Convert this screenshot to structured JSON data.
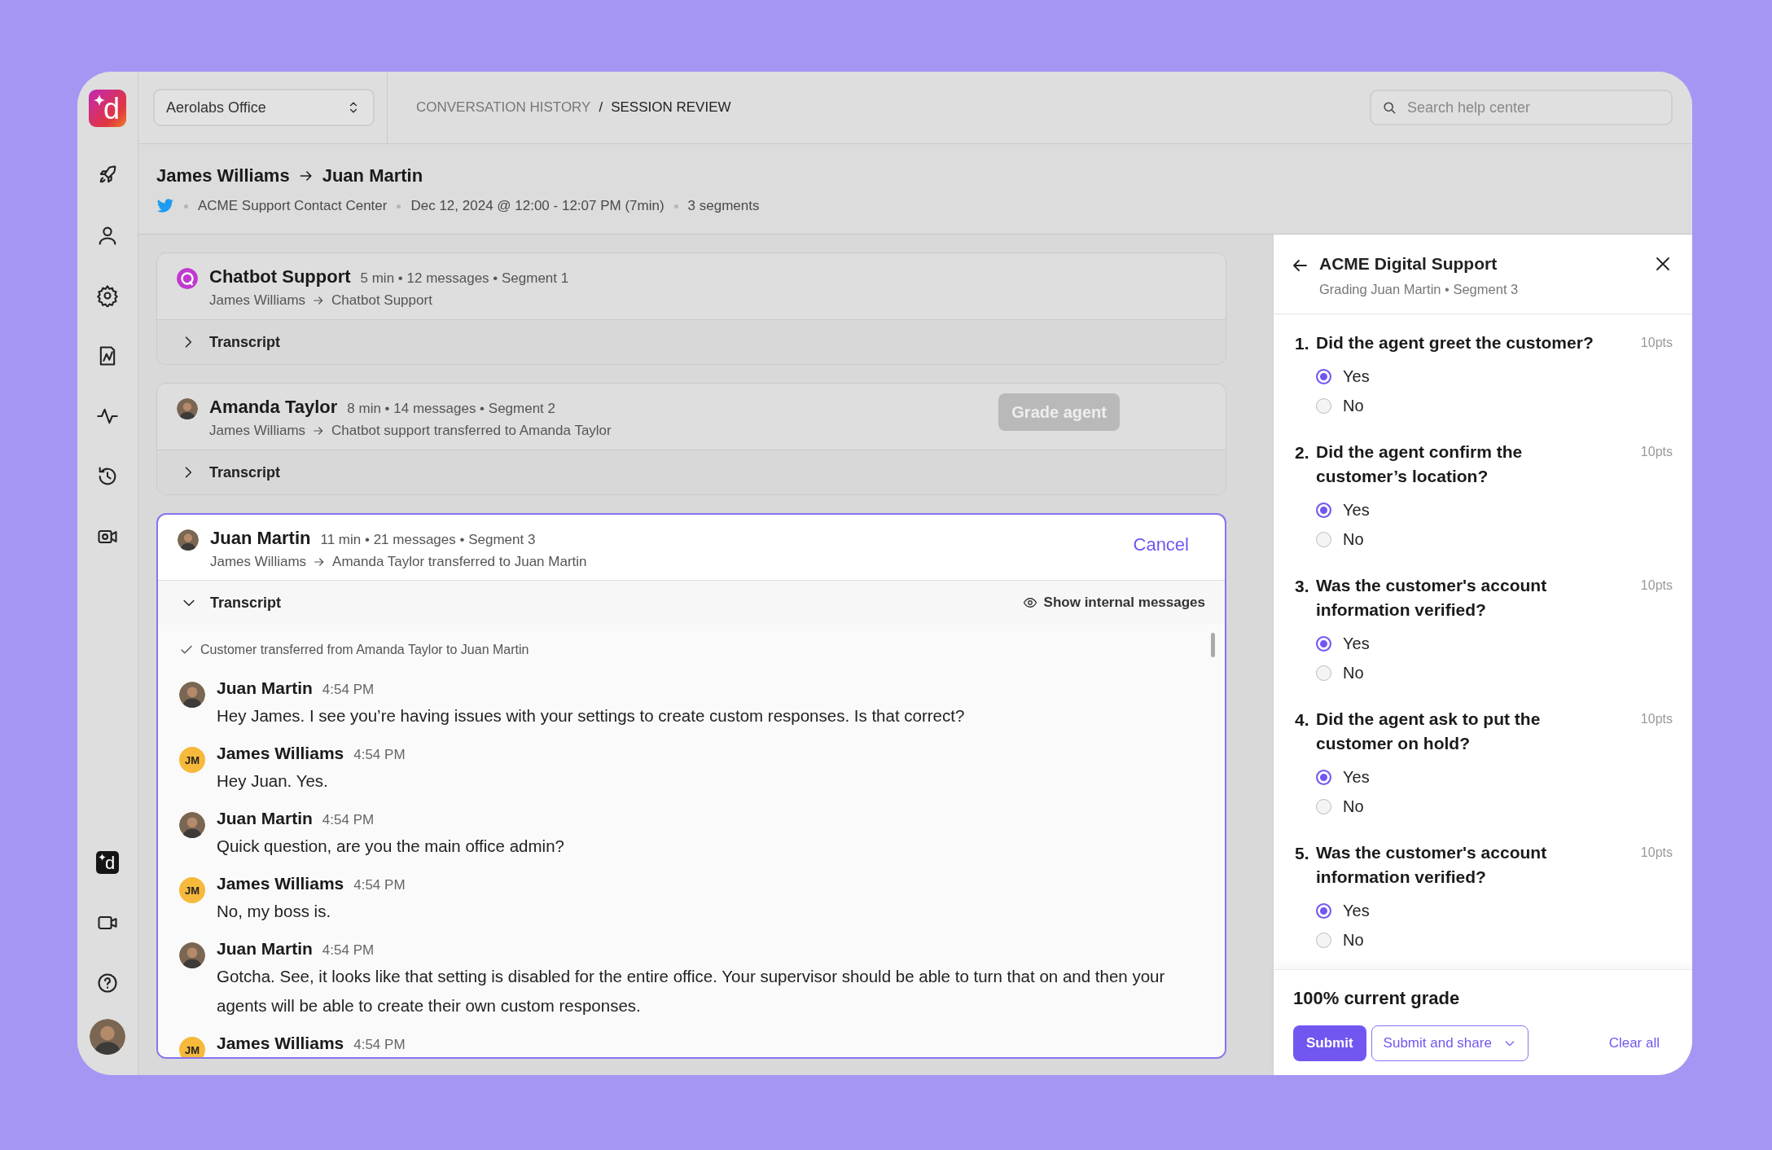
{
  "sidebar": {
    "logo": "d",
    "app_shortcut": "d"
  },
  "top_bar": {
    "workspace_select": "Aerolabs Office",
    "breadcrumb": [
      {
        "label": "CONVERSATION HISTORY",
        "current": false
      },
      {
        "label": "SESSION REVIEW",
        "current": true
      }
    ],
    "breadcrumb_separator": "/",
    "search": {
      "placeholder": "Search help center"
    }
  },
  "conversation": {
    "from": "James Williams",
    "to": "Juan Martin",
    "channel": "ACME Support Contact Center",
    "date": "Dec 12, 2024  @ 12:00 - 12:07 PM  (7min)",
    "segment_count": "3 segments"
  },
  "segments": [
    {
      "avatar": {
        "kind": "bot"
      },
      "name": "Chatbot Support",
      "details": "5 min • 12 messages • Segment 1",
      "from": "James Williams",
      "to": "Chatbot Support",
      "selected": false,
      "expanded": false,
      "transcript": {
        "label": "Transcript"
      }
    },
    {
      "avatar": {
        "kind": "photo"
      },
      "name": "Amanda Taylor",
      "details": "8 min • 14 messages • Segment 2",
      "from": "James Williams",
      "to": "Chatbot support transferred to Amanda Taylor",
      "selected": false,
      "expanded": false,
      "action": {
        "kind": "button",
        "label": "Grade agent",
        "disabled": true
      },
      "transcript": {
        "label": "Transcript"
      }
    },
    {
      "avatar": {
        "kind": "photo"
      },
      "name": "Juan Martin",
      "details": "11 min • 21 messages • Segment 3",
      "from": "James Williams",
      "to": "Amanda Taylor transferred to Juan Martin",
      "selected": true,
      "expanded": true,
      "action": {
        "kind": "link",
        "label": "Cancel"
      },
      "transcript": {
        "label": "Transcript",
        "toggle": "Show internal messages",
        "note": "Customer transferred from Amanda Taylor to Juan Martin",
        "messages": [
          {
            "sender": "Juan Martin",
            "time": "4:54 PM",
            "avatar": {
              "kind": "photo"
            },
            "text": "Hey James. I see you’re having issues with your settings to create custom responses. Is that correct?"
          },
          {
            "sender": "James Williams",
            "time": "4:54 PM",
            "avatar": {
              "kind": "initials",
              "text": "JM"
            },
            "text": "Hey Juan. Yes."
          },
          {
            "sender": "Juan Martin",
            "time": "4:54 PM",
            "avatar": {
              "kind": "photo"
            },
            "text": "Quick question, are you the main office admin?"
          },
          {
            "sender": "James Williams",
            "time": "4:54 PM",
            "avatar": {
              "kind": "initials",
              "text": "JM"
            },
            "text": "No, my boss is."
          },
          {
            "sender": "Juan Martin",
            "time": "4:54 PM",
            "avatar": {
              "kind": "photo"
            },
            "text": "Gotcha. See, it looks like that setting is disabled for the entire office. Your supervisor should be able to turn that on and then your agents will be able to create their own custom responses."
          },
          {
            "sender": "James Williams",
            "time": "4:54 PM",
            "avatar": {
              "kind": "initials",
              "text": "JM"
            }
          }
        ]
      }
    }
  ],
  "grading": {
    "title": "ACME Digital Support",
    "subtitle": "Grading Juan Martin • Segment 3",
    "questions": [
      {
        "number": "1.",
        "text": "Did the agent greet the customer?",
        "points": "10pts",
        "options": [
          {
            "label": "Yes",
            "selected": true
          },
          {
            "label": "No",
            "selected": false
          }
        ]
      },
      {
        "number": "2.",
        "text": "Did the agent confirm the customer’s location?",
        "points": "10pts",
        "options": [
          {
            "label": "Yes",
            "selected": true
          },
          {
            "label": "No",
            "selected": false
          }
        ]
      },
      {
        "number": "3.",
        "text": "Was the customer's account information verified?",
        "points": "10pts",
        "options": [
          {
            "label": "Yes",
            "selected": true
          },
          {
            "label": "No",
            "selected": false
          }
        ]
      },
      {
        "number": "4.",
        "text": "Did the agent ask to put the customer on hold?",
        "points": "10pts",
        "options": [
          {
            "label": "Yes",
            "selected": true
          },
          {
            "label": "No",
            "selected": false
          }
        ]
      },
      {
        "number": "5.",
        "text": "Was the customer's account information verified?",
        "points": "10pts",
        "options": [
          {
            "label": "Yes",
            "selected": true
          },
          {
            "label": "No",
            "selected": false
          }
        ]
      }
    ],
    "grade": "100% current grade",
    "submit": "Submit",
    "submit_and_share": "Submit and share",
    "clear": "Clear all"
  }
}
